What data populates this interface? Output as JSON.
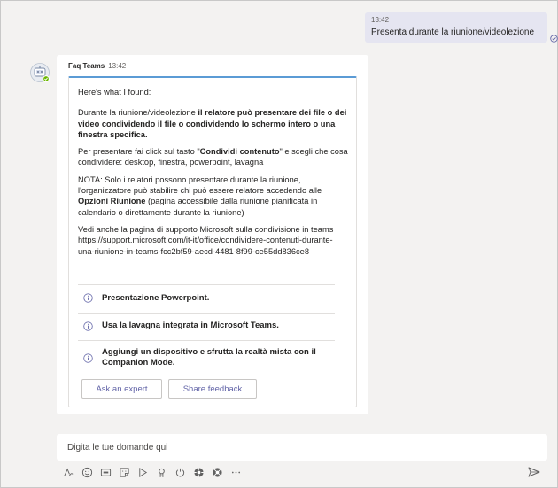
{
  "outgoing": {
    "time": "13:42",
    "text": "Presenta durante la riunione/videolezione"
  },
  "incoming": {
    "sender": "Faq Teams",
    "time": "13:42",
    "card": {
      "intro": "Here's what I found:",
      "p1": {
        "pre": "Durante la riunione/videolezione ",
        "bold": "il relatore può presentare dei file o dei video condividendo il file o condividendo lo schermo intero o una finestra specifica."
      },
      "p2": {
        "pre": "Per presentare fai click sul tasto \"",
        "bold": "Condividi contenuto",
        "post": "\" e scegli che cosa condividere: desktop, finestra, powerpoint, lavagna"
      },
      "p3": {
        "pre": "NOTA: Solo i relatori possono presentare durante la riunione, l'organizzatore può stabilire chi può essere relatore accedendo alle ",
        "bold": "Opzioni Riunione",
        "post": " (pagina accessibile dalla riunione pianificata in calendario o direttamente durante la riunione)"
      },
      "p4": "Vedi anche la pagina di supporto Microsoft sulla condivisione in teams https://support.microsoft.com/it-it/office/condividere-contenuti-durante-una-riunione-in-teams-fcc2bf59-aecd-4481-8f99-ce55dd836ce8",
      "actions": [
        {
          "label": "Presentazione Powerpoint."
        },
        {
          "label": "Usa la lavagna integrata in Microsoft Teams."
        },
        {
          "label": "Aggiungi un dispositivo e sfrutta la realtà mista con il Companion Mode."
        }
      ],
      "buttons": {
        "ask_expert": "Ask an expert",
        "share_feedback": "Share feedback"
      }
    }
  },
  "compose": {
    "placeholder": "Digita le tue domande qui"
  },
  "toolbar_icons": [
    "format-icon",
    "emoji-icon",
    "gif-icon",
    "sticker-icon",
    "meet-now-icon",
    "praise-icon",
    "loop-icon",
    "app-icon",
    "app-icon-2",
    "more-icon"
  ],
  "colors": {
    "accent": "#6264a7",
    "card_top_border": "#5b9bd5",
    "outgoing_bubble": "#e5e5f1",
    "background": "#f3f2f1"
  }
}
